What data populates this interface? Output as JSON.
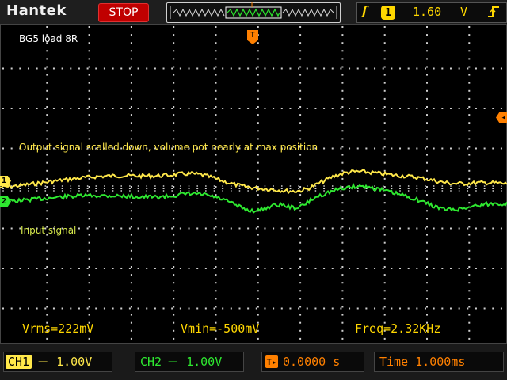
{
  "header": {
    "brand": "Hantek",
    "run_state": "STOP",
    "trigger": {
      "edge_symbol": "f",
      "channel": "1",
      "level": "1.60",
      "unit": "V",
      "slope_icon": "rising-edge-icon"
    }
  },
  "screen": {
    "label": "BG5 load 8R",
    "annotation_output": "Output signal scalled down, volume pot nearly at max position",
    "annotation_input": "Input signal",
    "ch1_marker": "1",
    "ch2_marker": "2",
    "trigger_position_marker": "T",
    "measurements": {
      "vrms": "Vrms=222mV",
      "vmin": "Vmin=-500mV",
      "freq": "Freq=2.32KHz"
    }
  },
  "footer": {
    "ch1": {
      "tag": "CH1",
      "coupling": "⎓",
      "scale": "1.00V"
    },
    "ch2": {
      "tag": "CH2",
      "coupling": "⎓",
      "scale": "1.00V"
    },
    "trigger_offset": "0.0000 s",
    "timebase": "Time 1.000ms"
  },
  "colors": {
    "ch1": "#ffe84a",
    "ch2": "#2ee830",
    "trigger": "#ff8000",
    "measurement": "#ffd700",
    "stop_badge": "#c00000"
  }
}
